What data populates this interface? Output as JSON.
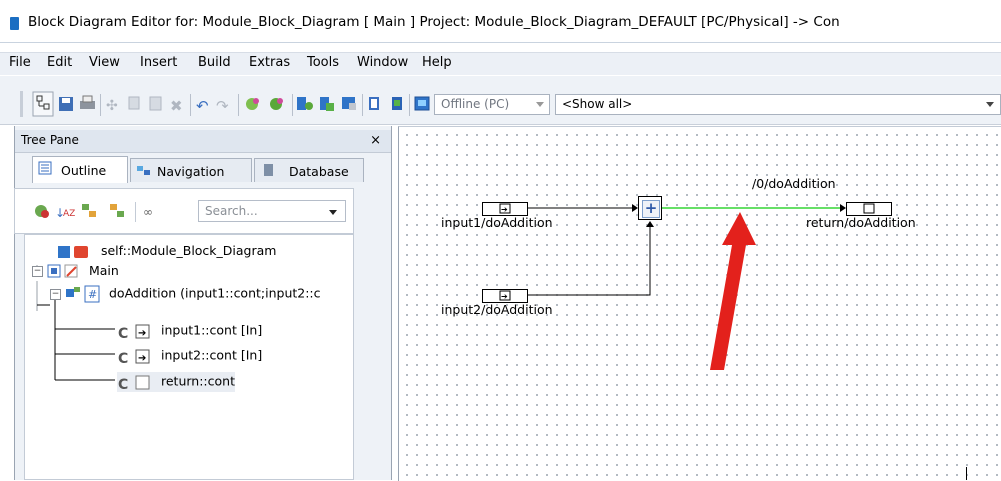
{
  "window": {
    "title": "Block Diagram Editor for: Module_Block_Diagram [ Main ] Project: Module_Block_Diagram_DEFAULT [PC/Physical] -> Con"
  },
  "menu": [
    "File",
    "Edit",
    "View",
    "Insert",
    "Build",
    "Extras",
    "Tools",
    "Window",
    "Help"
  ],
  "toolbar": {
    "mode_combo": "Offline (PC)",
    "filter_combo": "<Show all>"
  },
  "tree_pane": {
    "title": "Tree Pane",
    "close": "×",
    "tabs": [
      "Outline",
      "Navigation",
      "Database"
    ],
    "search_placeholder": "Search...",
    "items": {
      "root": "self::Module_Block_Diagram",
      "main": "Main",
      "function": "doAddition (input1::cont;input2::c",
      "param1": "input1::cont [In]",
      "param2": "input2::cont [In]",
      "param3": "return::cont"
    }
  },
  "diagram": {
    "input1_label": "input1/doAddition",
    "input2_label": "input2/doAddition",
    "return_label": "return/doAddition",
    "signal_label": "/0/doAddition",
    "plus_symbol": "+",
    "selected_wire_color": "#66e066",
    "annotation_arrow_color": "#e3211c"
  }
}
